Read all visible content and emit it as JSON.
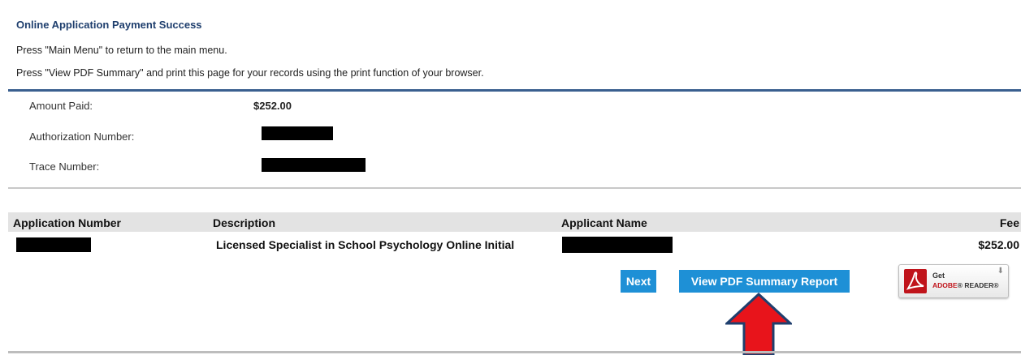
{
  "page": {
    "title": "Online Application Payment Success",
    "instruction_1": "Press \"Main Menu\" to return to the main menu.",
    "instruction_2": "Press \"View PDF Summary\" and print this page for your records using the print function of your browser."
  },
  "payment": {
    "amount_label": "Amount Paid:",
    "amount_value": "$252.00",
    "auth_label": "Authorization Number:",
    "trace_label": "Trace Number:"
  },
  "table": {
    "headers": [
      "Application Number",
      "Description",
      "Applicant Name",
      "Fee"
    ],
    "rows": [
      {
        "description": "Licensed Specialist in School Psychology Online Initial",
        "fee": "$252.00"
      }
    ]
  },
  "buttons": {
    "next": "Next",
    "view_pdf": "View PDF Summary Report"
  },
  "adobe": {
    "get": "Get",
    "brand": "ADOBE",
    "reader": "READER"
  },
  "colors": {
    "title": "#1f3f6e",
    "button": "#1e90d6",
    "annotation_arrow": "#e8141b"
  },
  "icons": [
    "adobe-acrobat-icon",
    "download-arrow-icon",
    "red-up-arrow-annotation"
  ]
}
